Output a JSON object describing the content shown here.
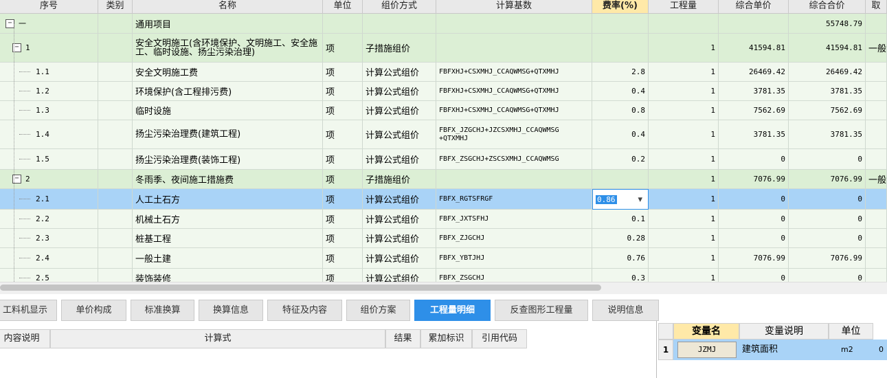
{
  "grid": {
    "columns": [
      "序号",
      "类别",
      "名称",
      "单位",
      "组价方式",
      "计算基数",
      "费率(%)",
      "工程量",
      "综合单价",
      "综合合价",
      "取"
    ],
    "rows": [
      {
        "seq": "一",
        "category": "",
        "name": "通用项目",
        "unit": "",
        "method": "",
        "base": "",
        "rate": "",
        "qty": "",
        "price": "",
        "total": "55748.79",
        "extra": "",
        "level": 0,
        "expander": "−"
      },
      {
        "seq": "1",
        "category": "",
        "name": "安全文明施工(含环境保护、文明施工、安全施工、临时设施、扬尘污染治理)",
        "unit": "项",
        "method": "子措施组价",
        "base": "",
        "rate": "",
        "qty": "1",
        "price": "41594.81",
        "total": "41594.81",
        "extra": "一般",
        "level": 1,
        "expander": "−"
      },
      {
        "seq": "1.1",
        "category": "",
        "name": "安全文明施工费",
        "unit": "项",
        "method": "计算公式组价",
        "base": "FBFXHJ+CSXMHJ_CCAQWMSG+QTXMHJ",
        "rate": "2.8",
        "qty": "1",
        "price": "26469.42",
        "total": "26469.42",
        "extra": "",
        "level": 2,
        "expander": ""
      },
      {
        "seq": "1.2",
        "category": "",
        "name": "环境保护(含工程排污费)",
        "unit": "项",
        "method": "计算公式组价",
        "base": "FBFXHJ+CSXMHJ_CCAQWMSG+QTXMHJ",
        "rate": "0.4",
        "qty": "1",
        "price": "3781.35",
        "total": "3781.35",
        "extra": "",
        "level": 2,
        "expander": ""
      },
      {
        "seq": "1.3",
        "category": "",
        "name": "临时设施",
        "unit": "项",
        "method": "计算公式组价",
        "base": "FBFXHJ+CSXMHJ_CCAQWMSG+QTXMHJ",
        "rate": "0.8",
        "qty": "1",
        "price": "7562.69",
        "total": "7562.69",
        "extra": "",
        "level": 2,
        "expander": ""
      },
      {
        "seq": "1.4",
        "category": "",
        "name": "扬尘污染治理费(建筑工程)",
        "unit": "项",
        "method": "计算公式组价",
        "base": "FBFX_JZGCHJ+JZCSXMHJ_CCAQWMSG +QTXMHJ",
        "rate": "0.4",
        "qty": "1",
        "price": "3781.35",
        "total": "3781.35",
        "extra": "",
        "level": 2,
        "expander": ""
      },
      {
        "seq": "1.5",
        "category": "",
        "name": "扬尘污染治理费(装饰工程)",
        "unit": "项",
        "method": "计算公式组价",
        "base": "FBFX_ZSGCHJ+ZSCSXMHJ_CCAQWMSG",
        "rate": "0.2",
        "qty": "1",
        "price": "0",
        "total": "0",
        "extra": "",
        "level": 2,
        "expander": ""
      },
      {
        "seq": "2",
        "category": "",
        "name": "冬雨季、夜间施工措施费",
        "unit": "项",
        "method": "子措施组价",
        "base": "",
        "rate": "",
        "qty": "1",
        "price": "7076.99",
        "total": "7076.99",
        "extra": "一般",
        "level": 1,
        "expander": "−"
      },
      {
        "seq": "2.1",
        "category": "",
        "name": "人工土石方",
        "unit": "项",
        "method": "计算公式组价",
        "base": "FBFX_RGTSFRGF",
        "rate": "0.86",
        "qty": "1",
        "price": "0",
        "total": "0",
        "extra": "",
        "level": 2,
        "expander": ""
      },
      {
        "seq": "2.2",
        "category": "",
        "name": "机械土石方",
        "unit": "项",
        "method": "计算公式组价",
        "base": "FBFX_JXTSFHJ",
        "rate": "0.1",
        "qty": "1",
        "price": "0",
        "total": "0",
        "extra": "",
        "level": 2,
        "expander": ""
      },
      {
        "seq": "2.3",
        "category": "",
        "name": "桩基工程",
        "unit": "项",
        "method": "计算公式组价",
        "base": "FBFX_ZJGCHJ",
        "rate": "0.28",
        "qty": "1",
        "price": "0",
        "total": "0",
        "extra": "",
        "level": 2,
        "expander": ""
      },
      {
        "seq": "2.4",
        "category": "",
        "name": "一般土建",
        "unit": "项",
        "method": "计算公式组价",
        "base": "FBFX_YBTJHJ",
        "rate": "0.76",
        "qty": "1",
        "price": "7076.99",
        "total": "7076.99",
        "extra": "",
        "level": 2,
        "expander": ""
      },
      {
        "seq": "2.5",
        "category": "",
        "name": "装饰装修",
        "unit": "项",
        "method": "计算公式组价",
        "base": "FBFX_ZSGCHJ",
        "rate": "0.3",
        "qty": "1",
        "price": "0",
        "total": "0",
        "extra": "",
        "level": 2,
        "expander": ""
      }
    ],
    "selected_row": 8,
    "editing_rate_value": "0.86"
  },
  "tabs": [
    "工料机显示",
    "单价构成",
    "标准换算",
    "换算信息",
    "特征及内容",
    "组价方案",
    "工程量明细",
    "反查图形工程量",
    "说明信息"
  ],
  "active_tab": 6,
  "detail": {
    "columns": [
      "内容说明",
      "计算式",
      "结果",
      "累加标识",
      "引用代码"
    ]
  },
  "variables": {
    "columns": [
      "变量名",
      "变量说明",
      "单位"
    ],
    "rows": [
      {
        "index": "1",
        "name": "JZMJ",
        "desc": "建筑面积",
        "unit": "m2",
        "value": "0"
      }
    ]
  },
  "colors": {
    "group_row": "#dcefd5",
    "child_row": "#f1f8ee",
    "selected_row": "#a9d3f7",
    "header": "#e9e9e9",
    "rate_header": "#ffe9a8",
    "active_tab": "#2e8fe8"
  }
}
